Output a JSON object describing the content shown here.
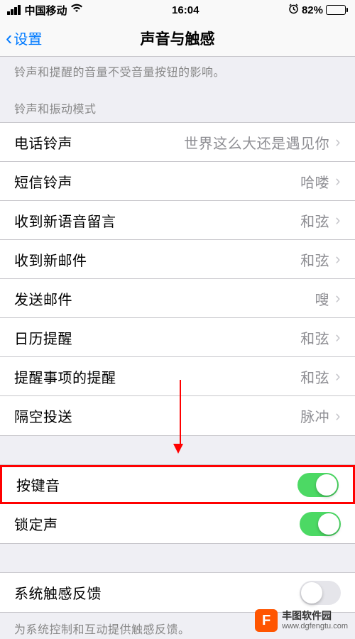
{
  "status_bar": {
    "carrier": "中国移动",
    "time": "16:04",
    "battery_pct": "82%"
  },
  "nav": {
    "back_label": "设置",
    "title": "声音与触感"
  },
  "description": "铃声和提醒的音量不受音量按钮的影响。",
  "section_header": "铃声和振动模式",
  "rows": {
    "phone_ringtone": {
      "label": "电话铃声",
      "value": "世界这么大还是遇见你"
    },
    "text_tone": {
      "label": "短信铃声",
      "value": "哈喽"
    },
    "voicemail": {
      "label": "收到新语音留言",
      "value": "和弦"
    },
    "new_mail": {
      "label": "收到新邮件",
      "value": "和弦"
    },
    "sent_mail": {
      "label": "发送邮件",
      "value": "嗖"
    },
    "calendar": {
      "label": "日历提醒",
      "value": "和弦"
    },
    "reminder": {
      "label": "提醒事项的提醒",
      "value": "和弦"
    },
    "airdrop": {
      "label": "隔空投送",
      "value": "脉冲"
    },
    "keyboard_clicks": {
      "label": "按键音"
    },
    "lock_sound": {
      "label": "锁定声"
    },
    "system_haptics": {
      "label": "系统触感反馈"
    }
  },
  "footer_text": "为系统控制和互动提供触感反馈。",
  "watermark": {
    "name": "丰图软件园",
    "url": "www.dgfengtu.com"
  }
}
